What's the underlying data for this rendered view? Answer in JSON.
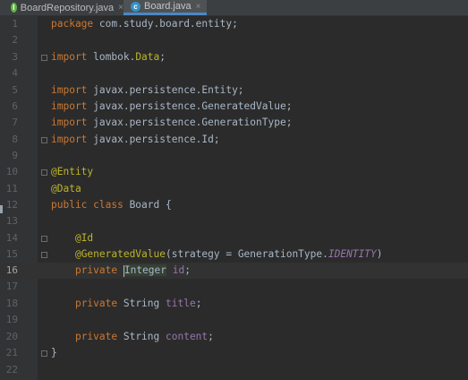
{
  "tabs": [
    {
      "label": "BoardRepository.java",
      "icon": "interface-icon",
      "icon_letter": "I",
      "icon_color": "#62b543",
      "active": false
    },
    {
      "label": "Board.java",
      "icon": "class-icon",
      "icon_letter": "c",
      "icon_color": "#3592c4",
      "active": true
    }
  ],
  "close_glyph": "×",
  "editor": {
    "current_line": 16,
    "lines": [
      {
        "n": "1"
      },
      {
        "n": "2"
      },
      {
        "n": "3"
      },
      {
        "n": "4"
      },
      {
        "n": "5"
      },
      {
        "n": "6"
      },
      {
        "n": "7"
      },
      {
        "n": "8"
      },
      {
        "n": "9"
      },
      {
        "n": "10"
      },
      {
        "n": "11"
      },
      {
        "n": "12"
      },
      {
        "n": "13"
      },
      {
        "n": "14"
      },
      {
        "n": "15"
      },
      {
        "n": "16"
      },
      {
        "n": "17"
      },
      {
        "n": "18"
      },
      {
        "n": "19"
      },
      {
        "n": "20"
      },
      {
        "n": "21"
      },
      {
        "n": "22"
      }
    ],
    "code": {
      "l1_kw": "package",
      "l1_rest": " com.study.board.entity;",
      "l3_kw": "import",
      "l3_pkg": " lombok.",
      "l3_cls": "Data",
      "l3_end": ";",
      "l5_kw": "import",
      "l5_rest": " javax.persistence.Entity;",
      "l6_kw": "import",
      "l6_rest": " javax.persistence.GeneratedValue;",
      "l7_kw": "import",
      "l7_rest": " javax.persistence.GenerationType;",
      "l8_kw": "import",
      "l8_rest": " javax.persistence.Id;",
      "l10": "@Entity",
      "l11": "@Data",
      "l12_kw": "public class",
      "l12_rest": " Board {",
      "l14": "@Id",
      "l15_ann": "@GeneratedValue",
      "l15_mid": "(strategy = GenerationType.",
      "l15_stat": "IDENTITY",
      "l15_end": ")",
      "l16_kw": "private",
      "l16_type": "Integer",
      "l16_fld": "id",
      "l16_end": ";",
      "l18_kw": "private",
      "l18_type": " String ",
      "l18_fld": "title",
      "l18_end": ";",
      "l20_kw": "private",
      "l20_type": " String ",
      "l20_fld": "content",
      "l20_end": ";",
      "l21": "}"
    }
  },
  "colors": {
    "keyword": "#cc7832",
    "annotation": "#bbb529",
    "field": "#9876aa",
    "text": "#a9b7c6",
    "background": "#2b2b2b"
  }
}
